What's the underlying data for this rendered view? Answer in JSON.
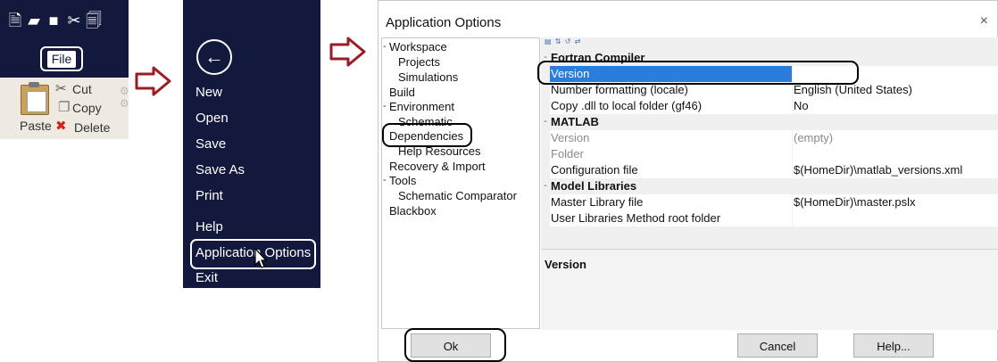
{
  "ribbon": {
    "file_label": "File",
    "paste_label": "Paste",
    "cut_label": "Cut",
    "copy_label": "Copy",
    "delete_label": "Delete"
  },
  "backstage": {
    "back_symbol": "←",
    "items": [
      "New",
      "Open",
      "Save",
      "Save As",
      "Print",
      "Help",
      "Application Options",
      "Exit"
    ]
  },
  "dialog": {
    "title": "Application Options",
    "close_symbol": "×",
    "tree": {
      "workspace": "Workspace",
      "projects": "Projects",
      "simulations": "Simulations",
      "build": "Build",
      "environment": "Environment",
      "schematic": "Schematic",
      "dependencies": "Dependencies",
      "help_resources": "Help Resources",
      "recovery_import": "Recovery & Import",
      "tools": "Tools",
      "schematic_comparator": "Schematic Comparator",
      "blackbox": "Blackbox"
    },
    "grid": {
      "fortran_cat": "Fortran Compiler",
      "fortran_version": "Version",
      "number_formatting": "Number formatting (locale)",
      "number_formatting_val": "English (United States)",
      "copy_dll": "Copy .dll to local folder (gf46)",
      "copy_dll_val": "No",
      "matlab_cat": "MATLAB",
      "matlab_version": "Version",
      "matlab_version_val": "(empty)",
      "folder": "Folder",
      "config_file": "Configuration file",
      "config_file_val": "$(HomeDir)\\matlab_versions.xml",
      "model_cat": "Model Libraries",
      "master_file": "Master Library file",
      "master_file_val": "$(HomeDir)\\master.pslx",
      "user_libs": "User Libraries Method root folder"
    },
    "description_title": "Version",
    "buttons": {
      "ok": "Ok",
      "cancel": "Cancel",
      "help": "Help..."
    }
  },
  "colors": {
    "backstage_bg": "#13193c",
    "arrow": "#9b1c22",
    "selection": "#2b7ddb"
  }
}
